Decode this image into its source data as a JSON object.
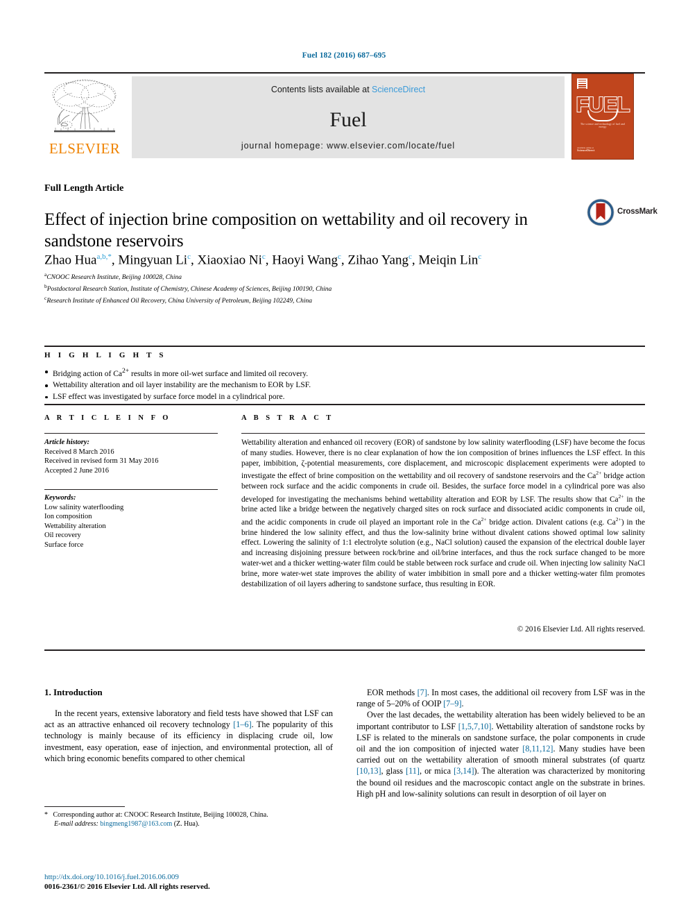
{
  "running_head": "Fuel 182 (2016) 687–695",
  "masthead": {
    "publisher": "ELSEVIER",
    "contents_text": "Contents lists available at ",
    "sciencedirect": "ScienceDirect",
    "journal_title": "Fuel",
    "homepage": "journal homepage: www.elsevier.com/locate/fuel",
    "cover": {
      "wordmark": "FUEL",
      "subtitle": "The science and technology of fuel and energy",
      "footer_top": "Available online at",
      "footer_bottom": "ScienceDirect"
    },
    "colors": {
      "link_blue": "#3a9ad9",
      "elsevier_orange": "#ef8200",
      "cover_orange": "#c0451d",
      "banner_gray": "#e3e3e3"
    }
  },
  "article": {
    "type": "Full Length Article",
    "title": "Effect of injection brine composition on wettability and oil recovery in sandstone reservoirs",
    "crossmark_label": "CrossMark",
    "authors_html": "Zhao Hua<sup>a,b,</sup><sup class=\"star\">*</sup>, Mingyuan Li<sup>c</sup>, Xiaoxiao Ni<sup>c</sup>, Haoyi Wang<sup>c</sup>, Zihao Yang<sup>c</sup>, Meiqin Lin<sup>c</sup>",
    "affiliations": [
      {
        "marker": "a",
        "text": "CNOOC Research Institute, Beijing 100028, China"
      },
      {
        "marker": "b",
        "text": "Postdoctoral Research Station, Institute of Chemistry, Chinese Academy of Sciences, Beijing 100190, China"
      },
      {
        "marker": "c",
        "text": "Research Institute of Enhanced Oil Recovery, China University of Petroleum, Beijing 102249, China"
      }
    ]
  },
  "highlights": {
    "heading": "H I G H L I G H T S",
    "items_html": [
      "Bridging action of Ca<sup>2+</sup> results in more oil-wet surface and limited oil recovery.",
      "Wettability alteration and oil layer instability are the mechanism to EOR by LSF.",
      "LSF effect was investigated by surface force model in a cylindrical pore."
    ]
  },
  "article_info": {
    "heading": "A R T I C L E  I N F O",
    "history_label": "Article history:",
    "history": [
      "Received 8 March 2016",
      "Received in revised form 31 May 2016",
      "Accepted 2 June 2016"
    ],
    "keywords_label": "Keywords:",
    "keywords": [
      "Low salinity waterflooding",
      "Ion composition",
      "Wettability alteration",
      "Oil recovery",
      "Surface force"
    ]
  },
  "abstract": {
    "heading": "A B S T R A C T",
    "body_html": "Wettability alteration and enhanced oil recovery (EOR) of sandstone by low salinity waterflooding (LSF) have become the focus of many studies. However, there is no clear explanation of how the ion composition of brines influences the LSF effect. In this paper, imbibition, &zeta;-potential measurements, core displacement, and microscopic displacement experiments were adopted to investigate the effect of brine composition on the wettability and oil recovery of sandstone reservoirs and the Ca<sup>2+</sup> bridge action between rock surface and the acidic components in crude oil. Besides, the surface force model in a cylindrical pore was also developed for investigating the mechanisms behind wettability alteration and EOR by LSF. The results show that Ca<sup>2+</sup> in the brine acted like a bridge between the negatively charged sites on rock surface and dissociated acidic components in crude oil, and the acidic components in crude oil played an important role in the Ca<sup>2+</sup> bridge action. Divalent cations (e.g. Ca<sup>2+</sup>) in the brine hindered the low salinity effect, and thus the low-salinity brine without divalent cations showed optimal low salinity effect. Lowering the salinity of 1:1 electrolyte solution (e.g., NaCl solution) caused the expansion of the electrical double layer and increasing disjoining pressure between rock/brine and oil/brine interfaces, and thus the rock surface changed to be more water-wet and a thicker wetting-water film could be stable between rock surface and crude oil. When injecting low salinity NaCl brine, more water-wet state improves the ability of water imbibition in small pore and a thicker wetting-water film promotes destabilization of oil layers adhering to sandstone surface, thus resulting in EOR.",
    "copyright": "© 2016 Elsevier Ltd. All rights reserved."
  },
  "introduction": {
    "section_title": "1. Introduction",
    "left_paragraph_html": "In the recent years, extensive laboratory and field tests have showed that LSF can act as an attractive enhanced oil recovery technology <span class=\"cite\">[1–6]</span>. The popularity of this technology is mainly because of its efficiency in displacing crude oil, low investment, easy operation, ease of injection, and environmental protection, all of which bring economic benefits compared to other chemical",
    "right_paragraph_1_html": "EOR methods <span class=\"cite\">[7]</span>. In most cases, the additional oil recovery from LSF was in the range of 5–20% of OOIP <span class=\"cite\">[7–9]</span>.",
    "right_paragraph_2_html": "Over the last decades, the wettability alteration has been widely believed to be an important contributor to LSF <span class=\"cite\">[1,5,7,10]</span>. Wettability alteration of sandstone rocks by LSF is related to the minerals on sandstone surface, the polar components in crude oil and the ion composition of injected water <span class=\"cite\">[8,11,12]</span>. Many studies have been carried out on the wettability alteration of smooth mineral substrates (of quartz <span class=\"cite\">[10,13]</span>, glass <span class=\"cite\">[11]</span>, or mica <span class=\"cite\">[3,14]</span>). The alteration was characterized by monitoring the bound oil residues and the macroscopic contact angle on the substrate in brines. High pH and low-salinity solutions can result in desorption of oil layer on"
  },
  "footer": {
    "corresponding_html": "<span class=\"star\">*</span> Corresponding author at: CNOOC Research Institute, Beijing 100028, China.",
    "email_label": "E-mail address:",
    "email": "bingmeng1987@163.com",
    "email_suffix": "(Z. Hua).",
    "doi": "http://dx.doi.org/10.1016/j.fuel.2016.06.009",
    "issn_line": "0016-2361/© 2016 Elsevier Ltd. All rights reserved."
  }
}
